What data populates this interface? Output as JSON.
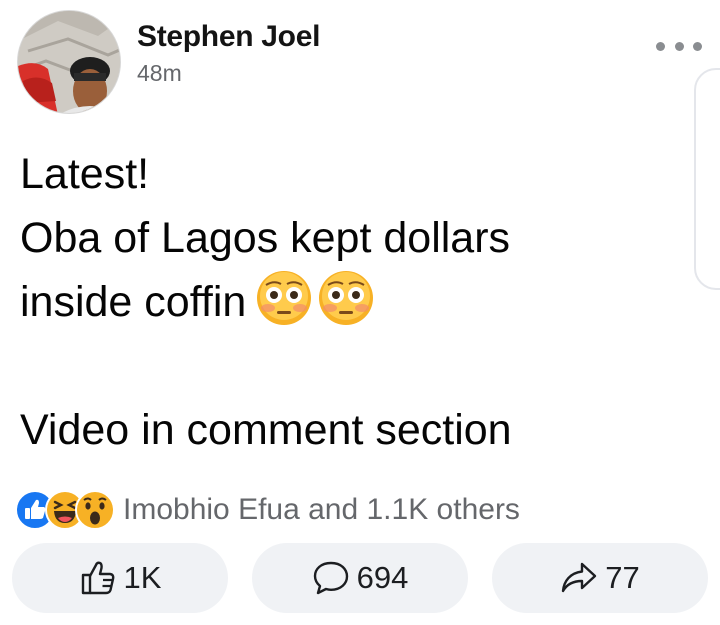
{
  "post": {
    "author": "Stephen Joel",
    "time": "48m",
    "text_lines": [
      "Latest!",
      "Oba of Lagos kept dollars",
      "inside coffin",
      "",
      "Video in comment section"
    ],
    "reactions_text": "Imobhio Efua and 1.1K others",
    "reaction_icons": [
      "like-icon",
      "laugh-icon",
      "wow-icon"
    ],
    "actions": {
      "like_count": "1K",
      "comment_count": "694",
      "share_count": "77"
    }
  },
  "colors": {
    "accent_blue": "#1877f2",
    "secondary_text": "#65676b",
    "button_bg": "#f0f2f5",
    "emoji_yellow": "#f7b125"
  }
}
